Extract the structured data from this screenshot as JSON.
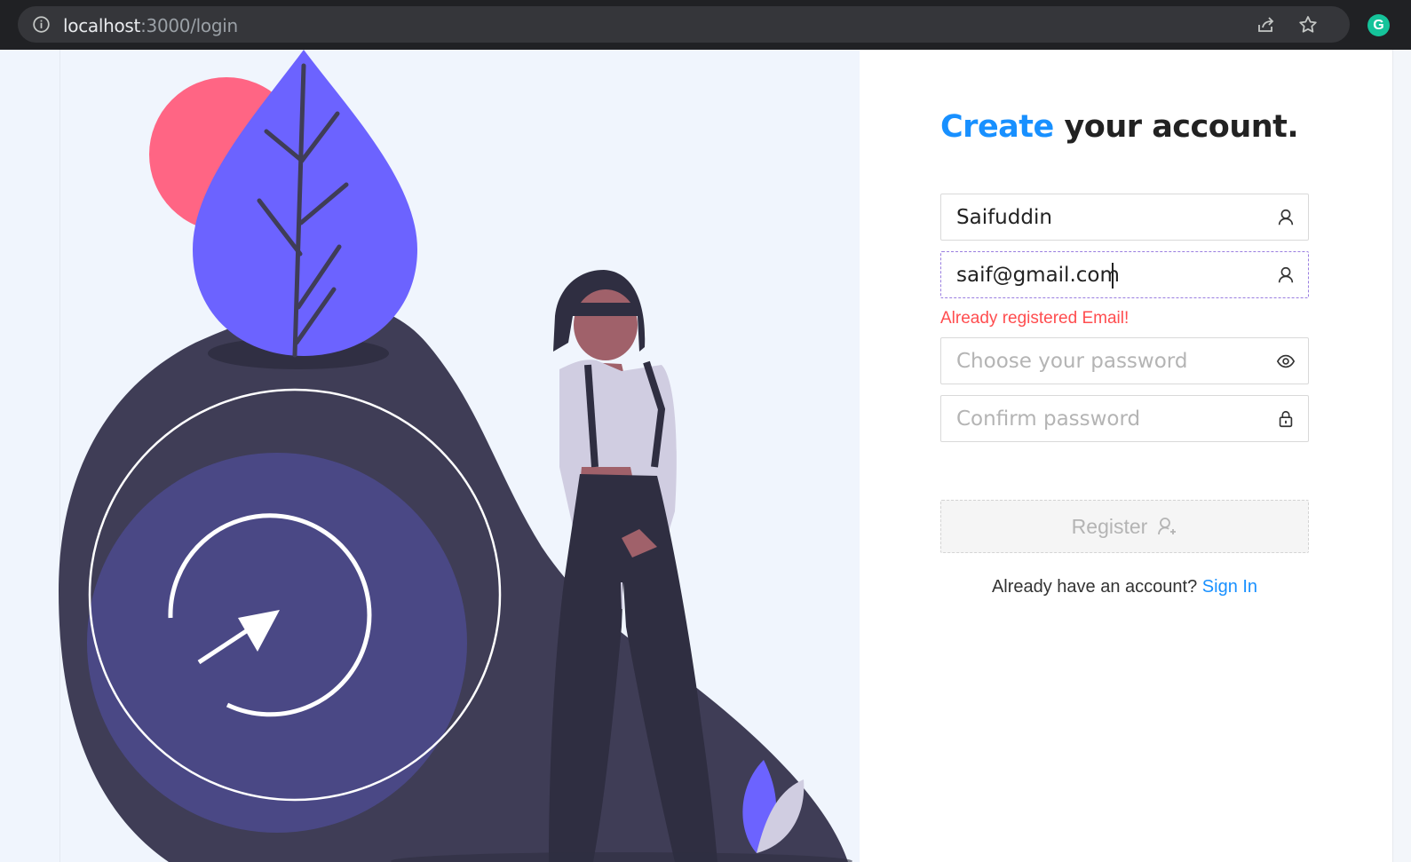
{
  "browser": {
    "url_host": "localhost",
    "url_path": ":3000/login",
    "extension_letter": "G",
    "icons": [
      "info-icon",
      "share-icon",
      "star-icon",
      "grammarly-icon"
    ]
  },
  "form": {
    "title_accent": "Create",
    "title_rest": " your account.",
    "fields": [
      {
        "value": "Saifuddin",
        "placeholder": "",
        "icon": "user-icon"
      },
      {
        "value": "saif@gmail.com",
        "placeholder": "",
        "icon": "user-icon"
      },
      {
        "value": "",
        "placeholder": "Choose your password",
        "icon": "eye-icon"
      },
      {
        "value": "",
        "placeholder": "Confirm password",
        "icon": "lock-icon"
      }
    ],
    "email_error": "Already registered Email!",
    "register_label": "Register",
    "register_icon": "user-add-icon",
    "signin_prompt": "Already have an account?",
    "signin_link": "Sign In"
  },
  "colors": {
    "accent": "#1890ff",
    "error": "#ff4d4f",
    "leaf": "#6c63ff",
    "circle_red": "#ff6584",
    "blob_dark": "#3f3d56",
    "circle_purple": "#4a4885"
  }
}
